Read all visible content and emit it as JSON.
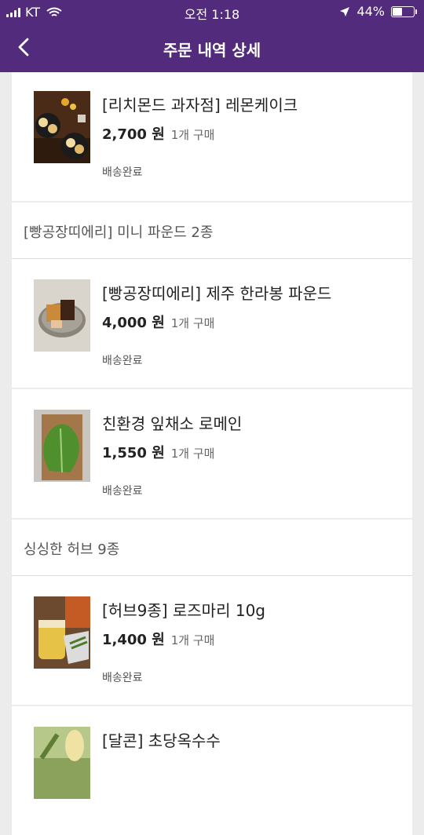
{
  "status_bar": {
    "carrier": "KT",
    "time": "오전 1:18",
    "battery": "44%",
    "battery_level": 0.44
  },
  "header": {
    "title": "주문 내역 상세"
  },
  "orders": [
    {
      "name": "[리치몬드 과자점] 레몬케이크",
      "price": "2,700 원",
      "quantity": "1개 구매",
      "status": "배송완료"
    }
  ],
  "groups": [
    {
      "title": "[빵공장띠에리] 미니 파운드 2종",
      "items": [
        {
          "name": "[빵공장띠에리] 제주 한라봉 파운드",
          "price": "4,000 원",
          "quantity": "1개 구매",
          "status": "배송완료"
        },
        {
          "name": "친환경 잎채소 로메인",
          "price": "1,550 원",
          "quantity": "1개 구매",
          "status": "배송완료"
        }
      ]
    },
    {
      "title": "싱싱한 허브 9종",
      "items": [
        {
          "name": "[허브9종] 로즈마리 10g",
          "price": "1,400 원",
          "quantity": "1개 구매",
          "status": "배송완료"
        },
        {
          "name": "[달콘] 초당옥수수"
        }
      ]
    }
  ],
  "colors": {
    "header_bg": "#532b7d",
    "page_bg": "#ececec"
  },
  "icons": [
    "signal-icon",
    "wifi-icon",
    "location-arrow-icon",
    "battery-icon",
    "back-arrow-icon"
  ]
}
